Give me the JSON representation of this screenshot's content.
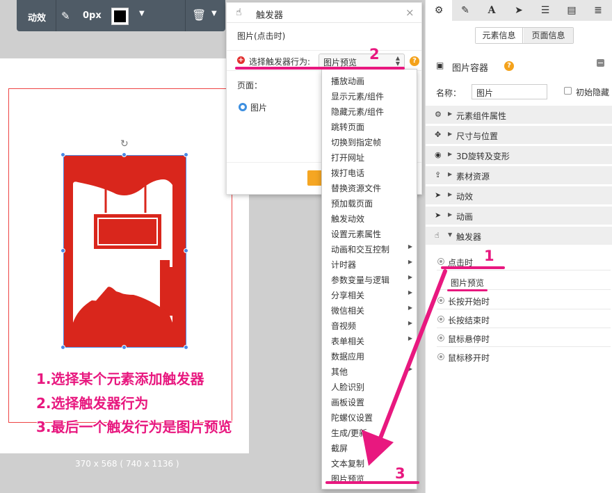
{
  "toolbar": {
    "animation_label": "动效",
    "border_width": "0px",
    "border_color": "#000000"
  },
  "canvas": {
    "size_text": "370 x 568 ( 740 x 1136 )"
  },
  "annotations": {
    "step1": "1.选择某个元素添加触发器",
    "step2": "2.选择触发器行为",
    "step3": "3.最后一个触发行为是图片预览",
    "num1": "1",
    "num2": "2",
    "num3": "3"
  },
  "dialog": {
    "title": "触发器",
    "subtitle": "图片(点击时)",
    "behavior_label": "选择触发器行为:",
    "selected_behavior": "图片预览",
    "page_label": "页面：",
    "radio_label": "图片"
  },
  "dropdown": {
    "options": [
      {
        "label": "播放动画",
        "submenu": false
      },
      {
        "label": "显示元素/组件",
        "submenu": false
      },
      {
        "label": "隐藏元素/组件",
        "submenu": false
      },
      {
        "label": "跳转页面",
        "submenu": false
      },
      {
        "label": "切换到指定帧",
        "submenu": false
      },
      {
        "label": "打开网址",
        "submenu": false
      },
      {
        "label": "拨打电话",
        "submenu": false
      },
      {
        "label": "替换资源文件",
        "submenu": false
      },
      {
        "label": "预加载页面",
        "submenu": false
      },
      {
        "label": "触发动效",
        "submenu": false
      },
      {
        "label": "设置元素属性",
        "submenu": false
      },
      {
        "label": "动画和交互控制",
        "submenu": true
      },
      {
        "label": "计时器",
        "submenu": true
      },
      {
        "label": "参数变量与逻辑",
        "submenu": true
      },
      {
        "label": "分享相关",
        "submenu": true
      },
      {
        "label": "微信相关",
        "submenu": true
      },
      {
        "label": "音视频",
        "submenu": true
      },
      {
        "label": "表单相关",
        "submenu": true
      },
      {
        "label": "数据应用",
        "submenu": false
      },
      {
        "label": "其他",
        "submenu": true
      },
      {
        "label": "人脸识别",
        "submenu": false
      },
      {
        "label": "画板设置",
        "submenu": false
      },
      {
        "label": "陀螺仪设置",
        "submenu": false
      },
      {
        "label": "生成/更新",
        "submenu": false
      },
      {
        "label": "截屏",
        "submenu": false
      },
      {
        "label": "文本复制",
        "submenu": false
      },
      {
        "label": "图片预览",
        "submenu": false
      }
    ]
  },
  "right_panel": {
    "tabs": [
      "gear-icon",
      "pencil-icon",
      "text-icon",
      "send-icon",
      "list-icon",
      "file-icon",
      "database-icon"
    ],
    "seg_element": "元素信息",
    "seg_page": "页面信息",
    "header_title": "图片容器",
    "name_label": "名称：",
    "name_value": "图片",
    "hide_label": "初始隐藏",
    "sections": [
      {
        "icon": "gear-icon",
        "label": "元素组件属性"
      },
      {
        "icon": "move-icon",
        "label": "尺寸与位置"
      },
      {
        "icon": "globe-icon",
        "label": "3D旋转及变形"
      },
      {
        "icon": "upload-icon",
        "label": "素材资源"
      },
      {
        "icon": "send-icon",
        "label": "动效"
      },
      {
        "icon": "send-icon",
        "label": "动画"
      },
      {
        "icon": "hand-icon",
        "label": "触发器"
      }
    ],
    "triggers": [
      "点击时",
      "长按开始时",
      "长按结束时",
      "鼠标悬停时",
      "鼠标移开时"
    ],
    "trigger_action": "图片预览"
  },
  "colors": {
    "accent_pink": "#e8187f",
    "image_red": "#d9261c",
    "help_orange": "#f4a21b"
  }
}
